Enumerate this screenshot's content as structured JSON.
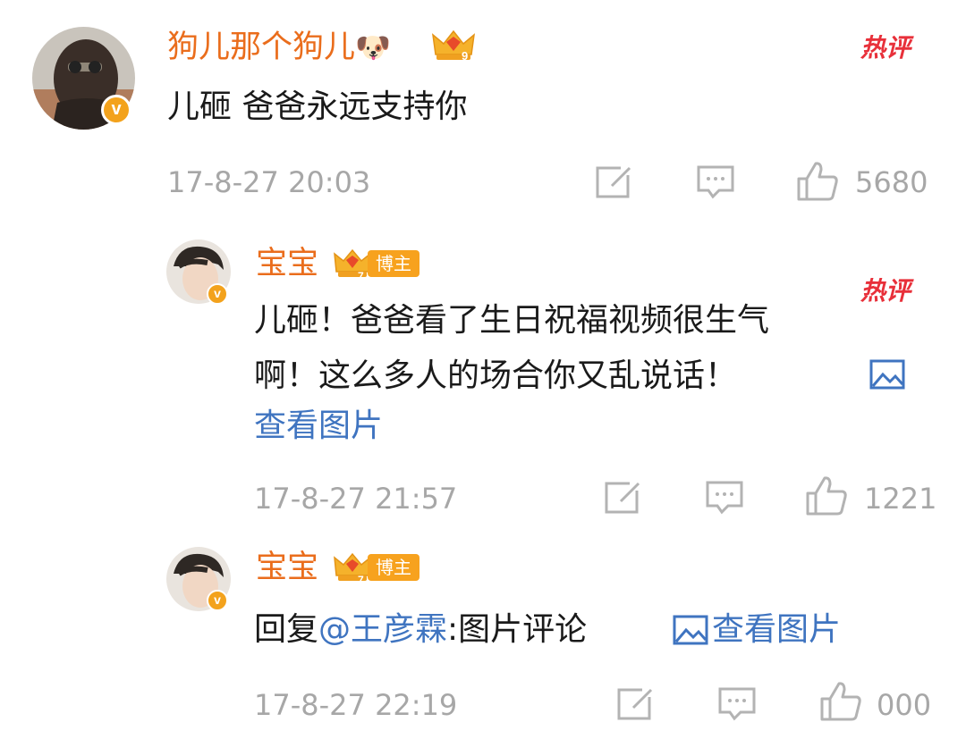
{
  "comments": [
    {
      "username": "狗儿那个狗儿",
      "name_emoji": "🐶",
      "level": "9",
      "text": "儿砸 爸爸永远支持你",
      "timestamp": "17-8-27 20:03",
      "likes": "5680",
      "hot_label": "热评",
      "verified_badge": "v"
    },
    {
      "username": "宝宝",
      "level": "7",
      "role_badge": "博主",
      "text_line1": "儿砸！爸爸看了生日祝福视频很生气",
      "text_line2": "啊！这么多人的场合你又乱说话！",
      "view_image_link": "查看图片",
      "timestamp": "17-8-27 21:57",
      "likes": "1221",
      "hot_label": "热评",
      "verified_badge": "v"
    },
    {
      "username": "宝宝",
      "level": "7",
      "role_badge": "博主",
      "reply_prefix": "回复",
      "mention": "@王彦霖",
      "reply_suffix": ":图片评论",
      "view_image_link": "查看图片",
      "timestamp": "17-8-27 22:19",
      "likes": "000",
      "verified_badge": "v"
    }
  ],
  "colors": {
    "username": "#ea6d1c",
    "link": "#3f74c0",
    "meta": "#a7a7a7",
    "hot": "#e8303a",
    "badge": "#f7a21e"
  },
  "icons": [
    "avatar-dog-mask",
    "avatar-boy",
    "crown-level-icon",
    "edit-icon",
    "comment-icon",
    "thumbs-up-icon",
    "image-icon"
  ]
}
